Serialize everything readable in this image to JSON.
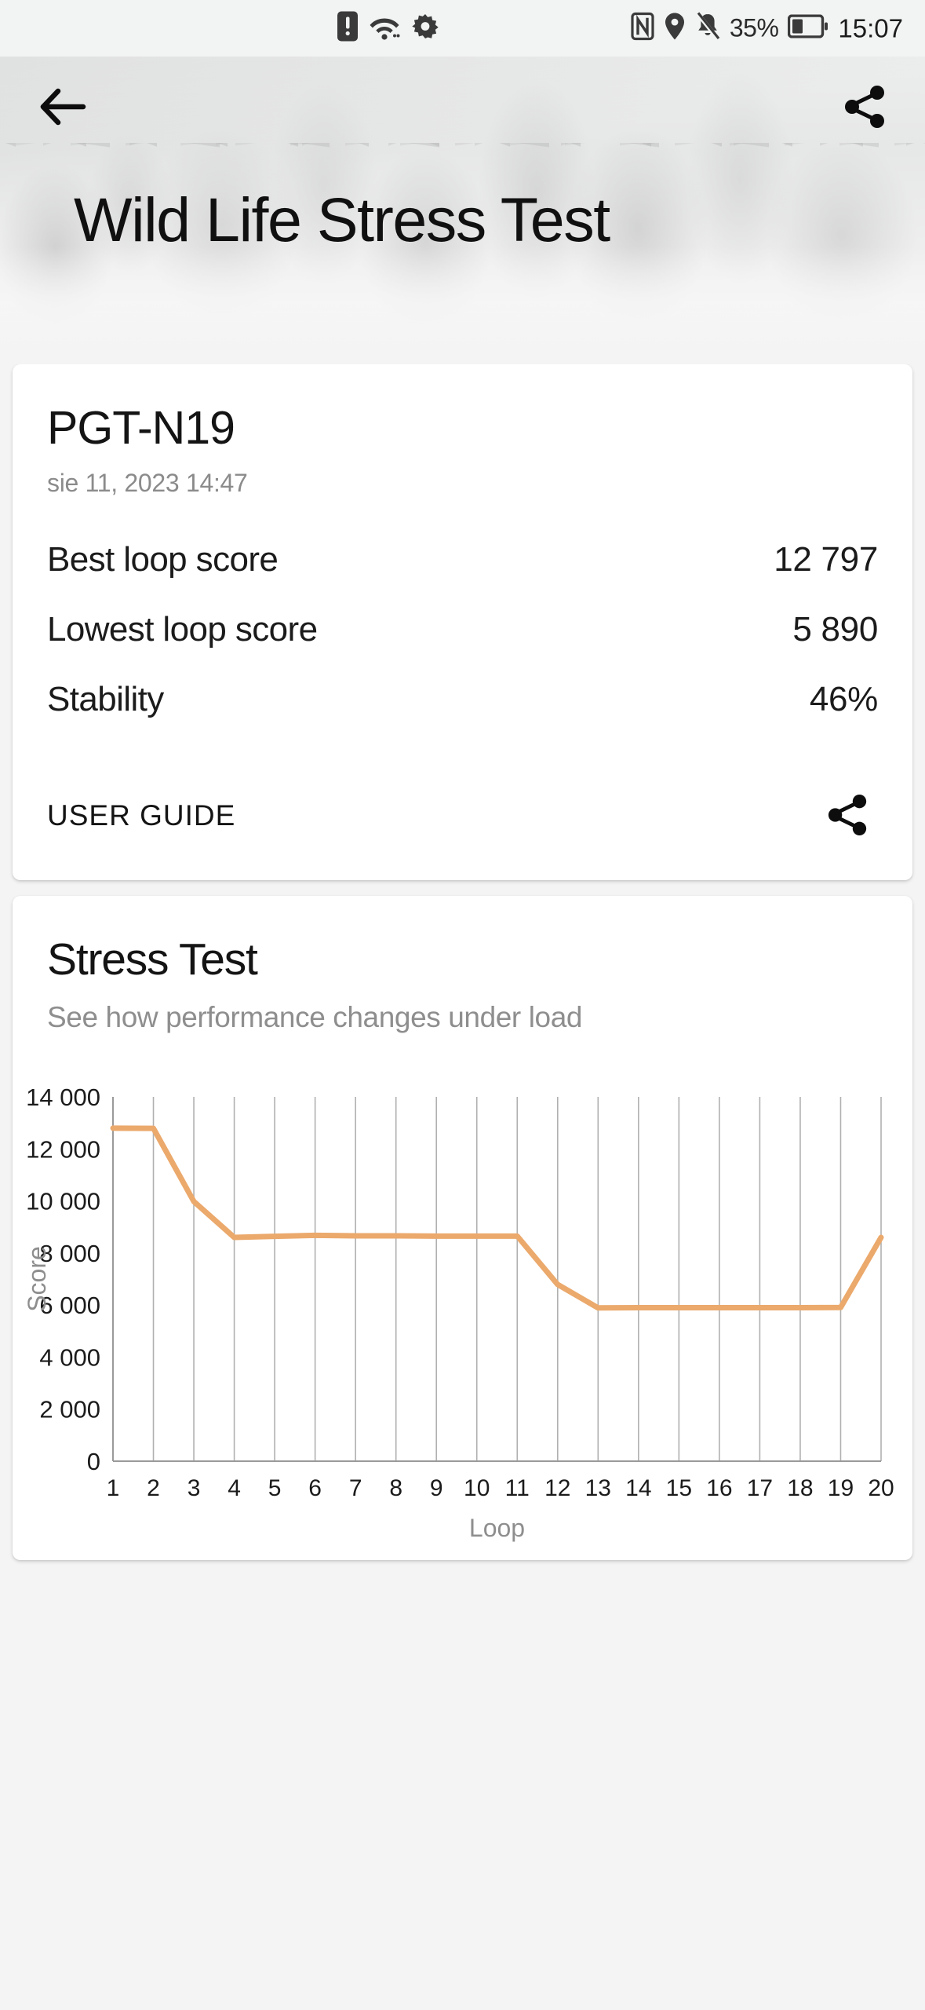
{
  "statusbar": {
    "left_icons": [
      "alert-icon",
      "wifi-icon",
      "settings-gear-icon"
    ],
    "right_icons": [
      "nfc-icon",
      "location-icon",
      "mute-bell-icon"
    ],
    "battery_percent": "35%",
    "clock": "15:07"
  },
  "header": {
    "back_label": "back-arrow",
    "share_label": "share",
    "title": "Wild Life Stress Test"
  },
  "result_card": {
    "name": "PGT-N19",
    "date": "sie 11, 2023 14:47",
    "rows": [
      {
        "label": "Best loop score",
        "value": "12 797"
      },
      {
        "label": "Lowest loop score",
        "value": "5 890"
      },
      {
        "label": "Stability",
        "value": "46%"
      }
    ],
    "user_guide_label": "USER GUIDE",
    "share_label": "share"
  },
  "stress_card": {
    "title": "Stress Test",
    "subtitle": "See how performance changes under load"
  },
  "colors": {
    "line": "#eba96c",
    "grid": "#b0b0b0",
    "axis": "#9a9a9a",
    "page_bg": "#f4f4f4",
    "card_bg": "#ffffff"
  },
  "chart_data": {
    "type": "line",
    "title": "",
    "xlabel": "Loop",
    "ylabel": "Score",
    "xlim": [
      1,
      20
    ],
    "ylim": [
      0,
      14000
    ],
    "yticks": [
      0,
      2000,
      4000,
      6000,
      8000,
      10000,
      12000,
      14000
    ],
    "ytick_labels": [
      "0",
      "2 000",
      "4 000",
      "6 000",
      "8 000",
      "10 000",
      "12 000",
      "14 000"
    ],
    "xticks": [
      1,
      2,
      3,
      4,
      5,
      6,
      7,
      8,
      9,
      10,
      11,
      12,
      13,
      14,
      15,
      16,
      17,
      18,
      19,
      20
    ],
    "xtick_labels": [
      "1",
      "2",
      "3",
      "4",
      "5",
      "6",
      "7",
      "8",
      "9",
      "10",
      "11",
      "12",
      "13",
      "14",
      "15",
      "16",
      "17",
      "18",
      "19",
      "20"
    ],
    "grid": true,
    "legend": false,
    "series": [
      {
        "name": "Score",
        "color": "#eba96c",
        "x": [
          1,
          2,
          3,
          4,
          5,
          6,
          7,
          8,
          9,
          10,
          11,
          12,
          13,
          14,
          15,
          16,
          17,
          18,
          19,
          20
        ],
        "values": [
          12797,
          12790,
          9980,
          8600,
          8640,
          8680,
          8660,
          8660,
          8650,
          8650,
          8650,
          6790,
          5890,
          5900,
          5900,
          5900,
          5900,
          5900,
          5905,
          8600
        ]
      }
    ]
  }
}
